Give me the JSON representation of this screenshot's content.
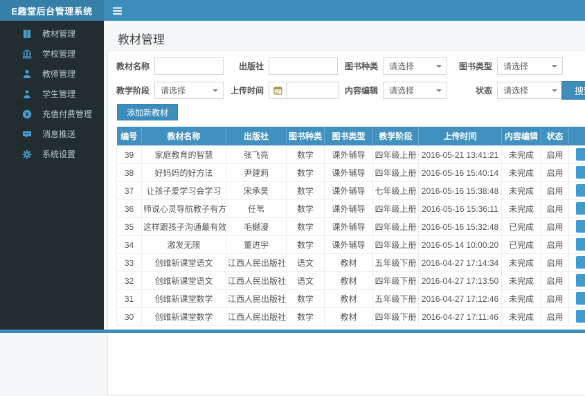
{
  "app": {
    "title": "E趣堂后台管理系统"
  },
  "sidebar": {
    "items": [
      {
        "icon": "book-icon",
        "label": "教材管理"
      },
      {
        "icon": "school-icon",
        "label": "学校管理"
      },
      {
        "icon": "teacher-icon",
        "label": "教师管理"
      },
      {
        "icon": "student-icon",
        "label": "学生管理"
      },
      {
        "icon": "payment-icon",
        "label": "充值付费管理"
      },
      {
        "icon": "message-icon",
        "label": "消息推送"
      },
      {
        "icon": "settings-icon",
        "label": "系统设置"
      }
    ]
  },
  "page": {
    "title": "教材管理"
  },
  "filters": {
    "row1": [
      {
        "label": "教材名称",
        "type": "text",
        "value": "",
        "placeholder": ""
      },
      {
        "label": "出版社",
        "type": "text",
        "value": "",
        "placeholder": ""
      },
      {
        "label": "图书种类",
        "type": "select",
        "value": "请选择"
      },
      {
        "label": "图书类型",
        "type": "select",
        "value": "请选择"
      }
    ],
    "row2": [
      {
        "label": "教学阶段",
        "type": "select",
        "value": "请选择"
      },
      {
        "label": "上传时间",
        "type": "date",
        "value": "",
        "placeholder": ""
      },
      {
        "label": "内容编辑",
        "type": "select",
        "value": "请选择"
      },
      {
        "label": "状态",
        "type": "select",
        "value": "请选择"
      }
    ],
    "search_label": "搜索"
  },
  "toolbar": {
    "add_label": "添加新教材"
  },
  "table": {
    "headers": [
      "编号",
      "教材名称",
      "出版社",
      "图书种类",
      "图书类型",
      "教学阶段",
      "上传时间",
      "内容编辑",
      "状态"
    ],
    "rows": [
      [
        "39",
        "家庭教育的智慧",
        "张飞亮",
        "数学",
        "课外辅导",
        "四年级上册",
        "2016-05-21 13:41:21",
        "未完成",
        "启用"
      ],
      [
        "38",
        "好妈妈的好方法",
        "尹建莉",
        "数学",
        "课外辅导",
        "四年级上册",
        "2016-05-16 15:40:14",
        "未完成",
        "启用"
      ],
      [
        "37",
        "让孩子爱学习会学习",
        "宋承昊",
        "数学",
        "课外辅导",
        "七年级上册",
        "2016-05-16 15:38:48",
        "未完成",
        "启用"
      ],
      [
        "36",
        "师说心灵导航教子有方",
        "任苇",
        "数学",
        "课外辅导",
        "四年级上册",
        "2016-05-16 15:36:11",
        "未完成",
        "启用"
      ],
      [
        "35",
        "这样跟孩子沟通最有效",
        "毛樾漫",
        "数学",
        "课外辅导",
        "四年级上册",
        "2016-05-16 15:32:48",
        "已完成",
        "启用"
      ],
      [
        "34",
        "激发无限",
        "董进宇",
        "数学",
        "课外辅导",
        "四年级上册",
        "2016-05-14 10:00:20",
        "已完成",
        "启用"
      ],
      [
        "33",
        "创维新课堂语文",
        "江西人民出版社",
        "语文",
        "教材",
        "五年级下册",
        "2016-04-27 17:14:34",
        "未完成",
        "启用"
      ],
      [
        "32",
        "创维新课堂语文",
        "江西人民出版社",
        "语文",
        "教材",
        "四年级下册",
        "2016-04-27 17:13:50",
        "未完成",
        "启用"
      ],
      [
        "31",
        "创维新课堂数学",
        "江西人民出版社",
        "数学",
        "教材",
        "五年级下册",
        "2016-04-27 17:12:46",
        "未完成",
        "启用"
      ],
      [
        "30",
        "创维新课堂数学",
        "江西人民出版社",
        "数学",
        "教材",
        "四年级下册",
        "2016-04-27 17:11:46",
        "未完成",
        "启用"
      ]
    ]
  },
  "colors": {
    "navbar": "#3c8dbc",
    "logo_bg": "#367fa9",
    "sidebar_bg": "#222d32",
    "sidebar_text": "#b8c7ce",
    "sidebar_icon": "#459fd0",
    "table_header_bg": "#4090c0",
    "button": "#3c8dbc"
  }
}
